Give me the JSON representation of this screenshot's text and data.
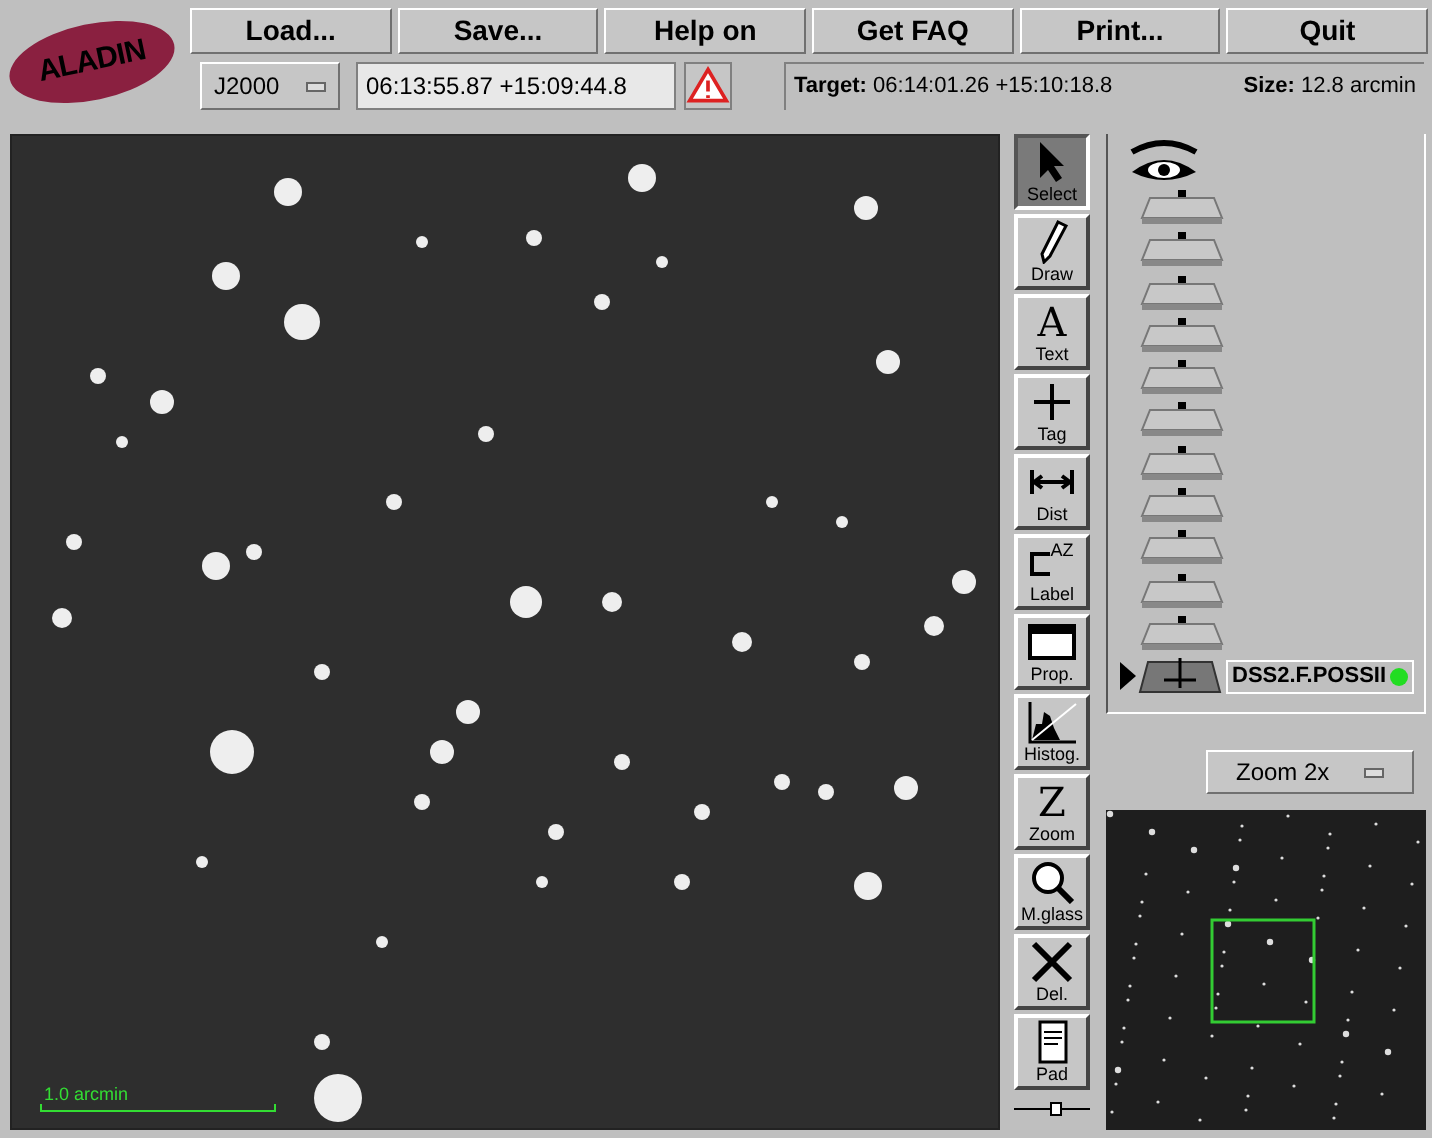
{
  "logo": {
    "text": "ALADIN"
  },
  "menu_buttons": [
    "Load...",
    "Save...",
    "Help on",
    "Get FAQ",
    "Print...",
    "Quit"
  ],
  "frame_select": {
    "value": "J2000"
  },
  "position_field": {
    "value": "06:13:55.87 +15:09:44.8"
  },
  "target": {
    "label": "Target:",
    "value": "06:14:01.26 +15:10:18.8",
    "size_label": "Size:",
    "size_value": "12.8 arcmin"
  },
  "view": {
    "scale_label": "1.0 arcmin"
  },
  "tools": [
    {
      "kind": "select",
      "label": "Select",
      "selected": true
    },
    {
      "kind": "draw",
      "label": "Draw",
      "selected": false
    },
    {
      "kind": "text",
      "label": "Text",
      "glyph": "A",
      "selected": false
    },
    {
      "kind": "tag",
      "label": "Tag",
      "selected": false
    },
    {
      "kind": "dist",
      "label": "Dist",
      "selected": false
    },
    {
      "kind": "label",
      "label": "Label",
      "glyph": "AZ",
      "selected": false
    },
    {
      "kind": "prop",
      "label": "Prop.",
      "selected": false
    },
    {
      "kind": "histog",
      "label": "Histog.",
      "selected": false
    },
    {
      "kind": "zoom",
      "label": "Zoom",
      "glyph": "Z",
      "selected": false
    },
    {
      "kind": "mglass",
      "label": "M.glass",
      "selected": false
    },
    {
      "kind": "del",
      "label": "Del.",
      "selected": false
    },
    {
      "kind": "pad",
      "label": "Pad",
      "selected": false
    }
  ],
  "layers": [
    {
      "kind": "empty"
    },
    {
      "kind": "empty"
    },
    {
      "kind": "empty"
    },
    {
      "kind": "empty"
    },
    {
      "kind": "empty"
    },
    {
      "kind": "empty"
    },
    {
      "kind": "empty"
    },
    {
      "kind": "empty"
    },
    {
      "kind": "empty"
    },
    {
      "kind": "empty"
    },
    {
      "kind": "empty"
    },
    {
      "kind": "image",
      "name": "DSS2.F.POSSII",
      "selected": true,
      "color": "#22dd22"
    }
  ],
  "zoom_select": {
    "value": "Zoom 2x"
  },
  "tool_slider": {
    "level": 0.55
  }
}
